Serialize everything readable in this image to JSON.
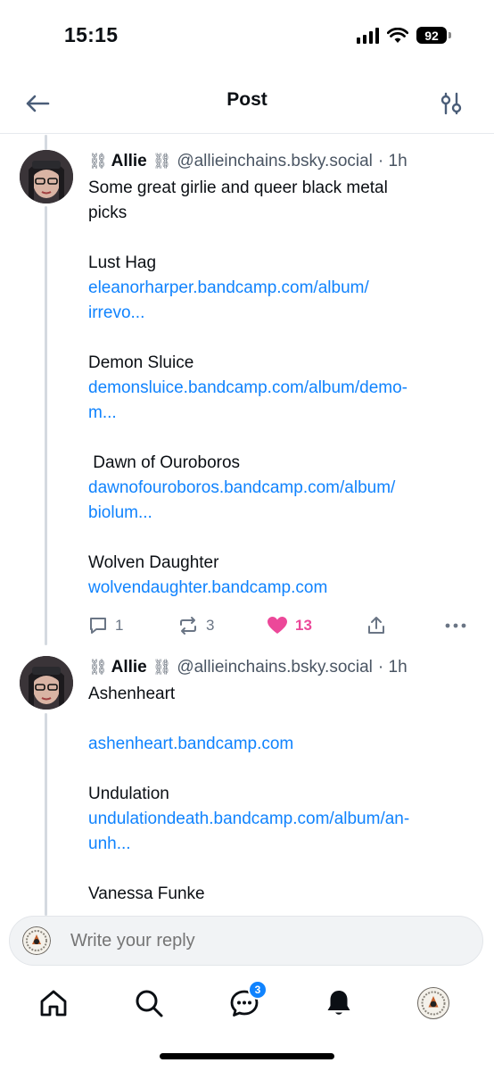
{
  "status": {
    "time": "15:15",
    "battery": "92"
  },
  "header": {
    "title": "Post"
  },
  "posts": [
    {
      "name": "Allie",
      "chain_before": "⛓",
      "chain_after": "⛓",
      "handle": "@allieinchains.bsky.social",
      "time": "· 1h",
      "lines": [
        "Some great girlie and queer black metal",
        "picks",
        "Lust Hag",
        "eleanorharper.bandcamp.com/album/",
        "irrevo...",
        "Demon Sluice",
        "demonsluice.bandcamp.com/album/demo-",
        "m...",
        " Dawn of Ouroboros",
        "dawnofouroboros.bandcamp.com/album/",
        "biolum...",
        "Wolven Daughter",
        "wolvendaughter.bandcamp.com"
      ],
      "stats": {
        "replies": "1",
        "reposts": "3",
        "likes": "13"
      }
    },
    {
      "name": "Allie",
      "chain_before": "⛓",
      "chain_after": "⛓",
      "handle": "@allieinchains.bsky.social",
      "time": "· 1h",
      "lines": [
        "Ashenheart",
        "ashenheart.bandcamp.com",
        "Undulation",
        "undulationdeath.bandcamp.com/album/an-",
        "unh...",
        "Vanessa Funke"
      ]
    }
  ],
  "reply": {
    "placeholder": "Write your reply"
  },
  "nav": {
    "items": [
      "home-icon",
      "search-icon",
      "chat-icon",
      "bell-icon",
      "profile-avatar"
    ],
    "chat_badge": "3"
  },
  "colors": {
    "link": "#1083fe",
    "like": "#ec4899",
    "muted": "#6a7585",
    "thread_line": "#d4d9e0"
  }
}
